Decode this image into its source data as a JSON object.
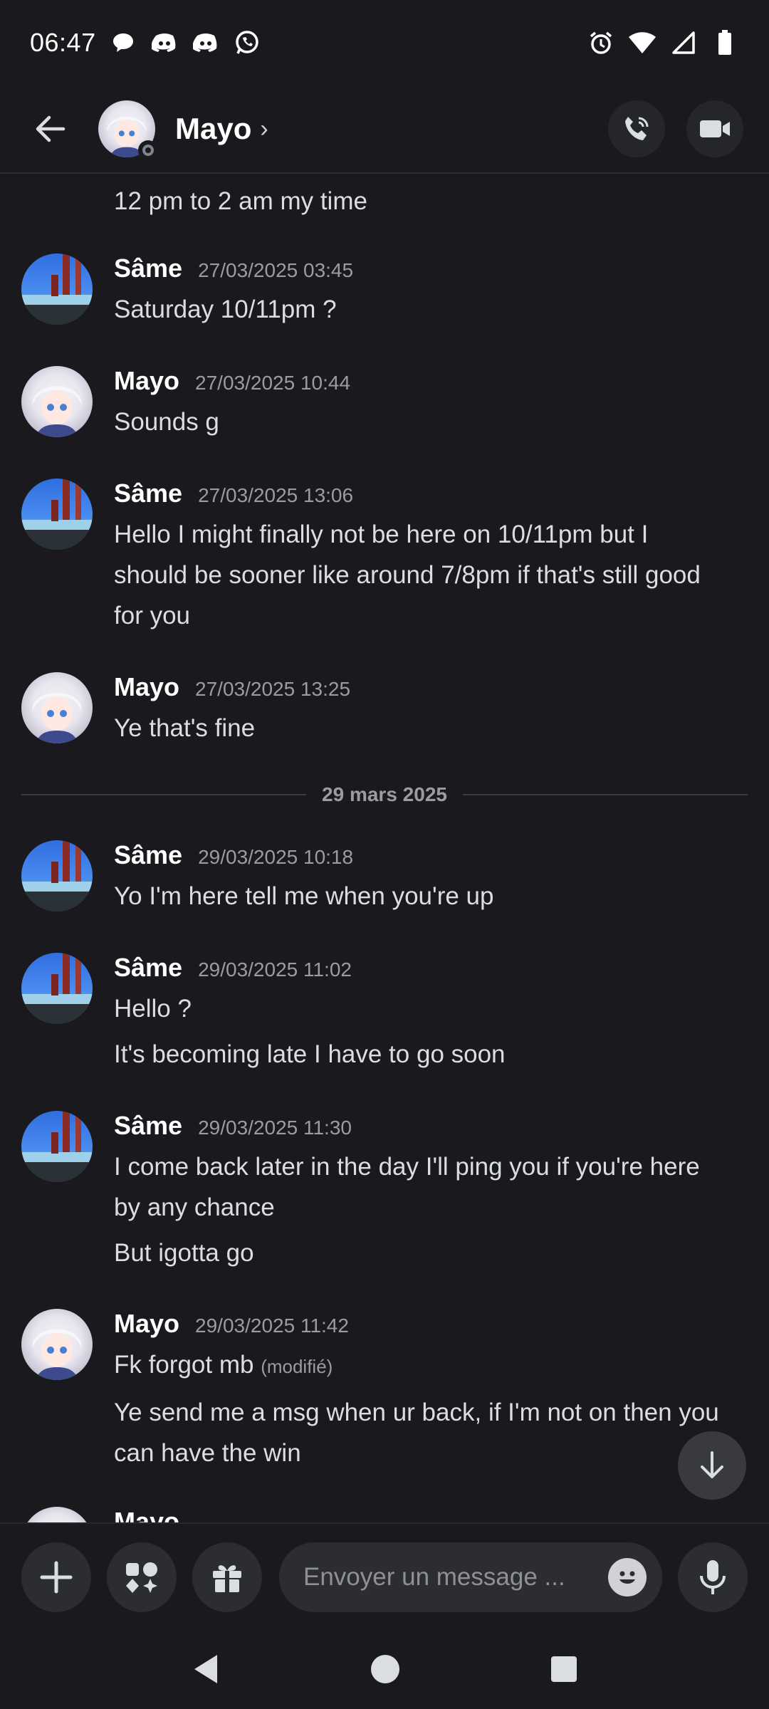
{
  "status_bar": {
    "time": "06:47",
    "notification_icons": [
      "chat-bubble-icon",
      "discord-icon",
      "discord-icon",
      "whatsapp-icon"
    ],
    "system_icons": [
      "alarm-icon",
      "wifi-icon",
      "signal-icon",
      "battery-icon"
    ]
  },
  "header": {
    "name": "Mayo",
    "chevron": "›",
    "status": "offline"
  },
  "messages": {
    "m0": {
      "text": "12 pm to 2 am my time"
    },
    "m1": {
      "author": "Sâme",
      "timestamp": "27/03/2025 03:45",
      "text": "Saturday 10/11pm ?"
    },
    "m2": {
      "author": "Mayo",
      "timestamp": "27/03/2025 10:44",
      "text": "Sounds g"
    },
    "m3": {
      "author": "Sâme",
      "timestamp": "27/03/2025 13:06",
      "text": "Hello I might finally not be here on 10/11pm but I should be sooner like around 7/8pm if that's still good for you"
    },
    "m4": {
      "author": "Mayo",
      "timestamp": "27/03/2025 13:25",
      "text": "Ye that's fine"
    },
    "date_divider": "29 mars 2025",
    "m5": {
      "author": "Sâme",
      "timestamp": "29/03/2025 10:18",
      "text": "Yo I'm here tell me when you're up"
    },
    "m6": {
      "author": "Sâme",
      "timestamp": "29/03/2025 11:02",
      "text": "Hello ?",
      "cont": "It's becoming late I have to go soon"
    },
    "m7": {
      "author": "Sâme",
      "timestamp": "29/03/2025 11:30",
      "text": "I come back later in the day I'll ping you if you're here by any chance",
      "cont": "But igotta go"
    },
    "m8": {
      "author": "Mayo",
      "timestamp": "29/03/2025 11:42",
      "text": "Fk forgot mb",
      "edited": "(modifié)",
      "cont": "Ye send me a msg when ur back, if I'm not on then you can have the win"
    },
    "m9": {
      "author": "Mayo"
    }
  },
  "composer": {
    "placeholder": "Envoyer un message ..."
  },
  "colors": {
    "background": "#1a1a1e",
    "author": "#ffffff",
    "timestamp": "#9a9ca3",
    "button_bg": "#2b2d33"
  }
}
